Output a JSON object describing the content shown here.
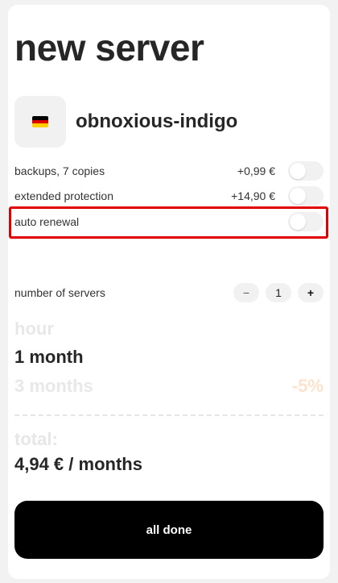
{
  "title": "new server",
  "server": {
    "name": "obnoxious-indigo",
    "flag_icon": "germany-flag-icon",
    "flag_colors": [
      "#000000",
      "#dd0000",
      "#ffce00"
    ]
  },
  "options": [
    {
      "label": "backups, 7 copies",
      "price": "+0,99 €",
      "enabled": false
    },
    {
      "label": "extended protection",
      "price": "+14,90 €",
      "enabled": false
    },
    {
      "label": "auto renewal",
      "price": "",
      "enabled": false
    }
  ],
  "servers_count": {
    "label": "number of servers",
    "minus": "−",
    "value": "1",
    "plus": "+"
  },
  "periods": [
    {
      "label": "hour",
      "selected": false
    },
    {
      "label": "1 month",
      "selected": true
    },
    {
      "label": "3 months",
      "selected": false,
      "discount": "-5%"
    }
  ],
  "total": {
    "label": "total:",
    "value": "4,94 € / months"
  },
  "submit_label": "all done",
  "colors": {
    "highlight": "#e00000",
    "button": "#000000",
    "discount": "#fde2cc"
  }
}
